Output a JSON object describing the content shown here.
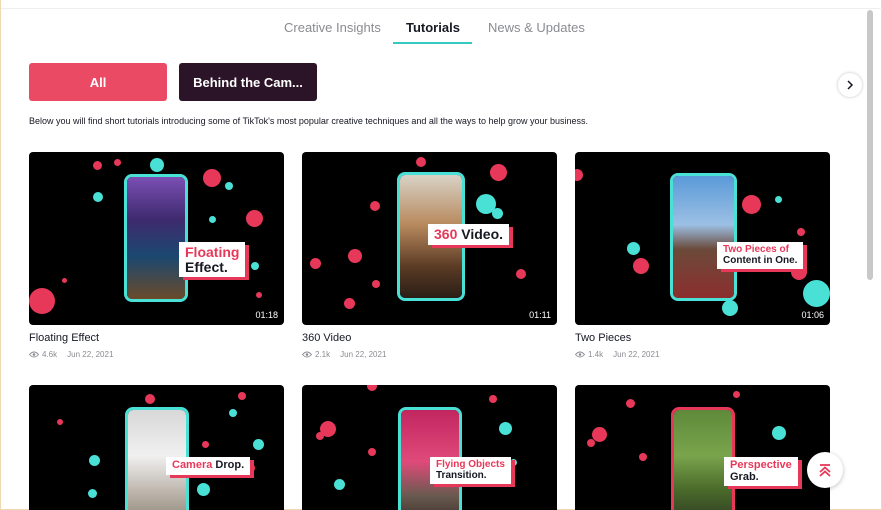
{
  "tabs": [
    {
      "label": "Creative Insights",
      "active": false
    },
    {
      "label": "Tutorials",
      "active": true
    },
    {
      "label": "News & Updates",
      "active": false
    }
  ],
  "filters": {
    "all_label": "All",
    "behind_label": "Behind the Cam..."
  },
  "description": "Below you will find short tutorials introducing some of TikTok's most popular creative techniques and all the ways to help grow your business.",
  "videos": [
    {
      "title": "Floating Effect",
      "views": "4.6k",
      "date": "Jun 22, 2021",
      "duration": "01:18",
      "overlay_line1": "Floating",
      "overlay_line2": "Effect."
    },
    {
      "title": "360 Video",
      "views": "2.1k",
      "date": "Jun 22, 2021",
      "duration": "01:11",
      "overlay_hl": "360",
      "overlay_rest": "Video."
    },
    {
      "title": "Two Pieces",
      "views": "1.4k",
      "date": "Jun 22, 2021",
      "duration": "01:06",
      "overlay_line1": "Two Pieces of",
      "overlay_line2": "Content in One."
    },
    {
      "overlay_hl": "Camera",
      "overlay_rest": "Drop."
    },
    {
      "overlay_line1": "Flying Objects",
      "overlay_line2": "Transition."
    },
    {
      "overlay_line1": "Perspective",
      "overlay_line2": "Grab."
    }
  ],
  "colors": {
    "accent_pink": "#eb4a64",
    "accent_teal": "#35c9c4",
    "dark_pill": "#2c1428"
  },
  "icons": {
    "next": "chevron-right-icon",
    "views": "eye-icon",
    "back_to_top": "arrow-up-to-top-icon"
  }
}
